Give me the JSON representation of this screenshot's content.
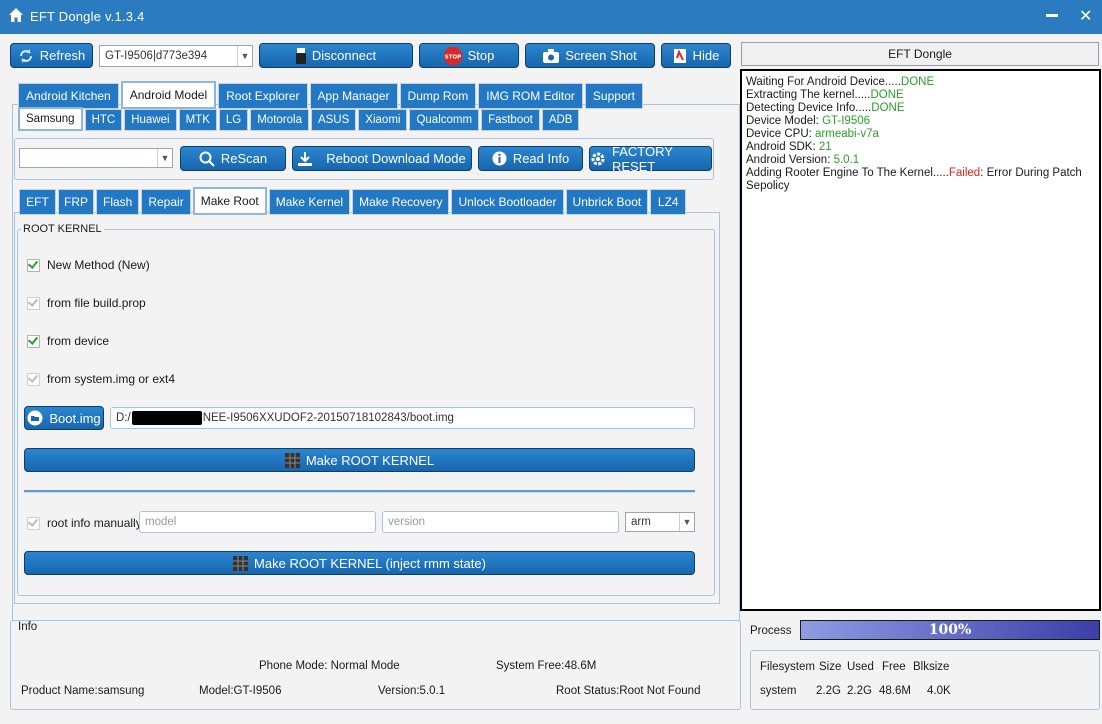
{
  "window": {
    "title": "EFT Dongle  v.1.3.4"
  },
  "toolbar": {
    "refresh": "Refresh",
    "device_combo": "GT-I9506|d773e394",
    "disconnect": "Disconnect",
    "stop": "Stop",
    "stop_sign": "STOP",
    "screenshot": "Screen Shot",
    "hide": "Hide"
  },
  "right_header": "EFT Dongle",
  "main_tabs": [
    "Android Kitchen",
    "Android Model",
    "Root Explorer",
    "App Manager",
    "Dump Rom",
    "IMG ROM Editor",
    "Support"
  ],
  "brand_tabs": [
    "Samsung",
    "HTC",
    "Huawei",
    "MTK",
    "LG",
    "Motorola",
    "ASUS",
    "Xiaomi",
    "Qualcomm",
    "Fastboot",
    "ADB"
  ],
  "actions": {
    "model_combo": "",
    "rescan": "ReScan",
    "reboot_download": "Reboot  Download Mode",
    "read_info": "Read Info",
    "factory_reset": "FACTORY RESET"
  },
  "op_tabs": [
    "EFT",
    "FRP",
    "Flash",
    "Repair",
    "Make Root",
    "Make Kernel",
    "Make Recovery",
    "Unlock Bootloader",
    "Unbrick Boot",
    "LZ4"
  ],
  "root_kernel": {
    "group_title": "ROOT KERNEL",
    "opt_new_method": "New Method (New)",
    "opt_file_build": "from file build.prop",
    "opt_device": "from device",
    "opt_system_img": "from system.img or ext4",
    "boot_button": "Boot.img",
    "boot_path_prefix": "D:/",
    "boot_path_suffix": "NEE-I9506XXUDOF2-20150718102843/boot.img",
    "make_button": "Make  ROOT KERNEL",
    "root_info_manually": "root info manually",
    "model_placeholder": "model",
    "version_placeholder": "version",
    "arch": "arm",
    "make_inject_button": "Make  ROOT KERNEL (inject rmm state)"
  },
  "log": {
    "l1a": "Waiting For Android Device.....",
    "l1b": "DONE",
    "l2a": "Extracting The kernel.....",
    "l2b": "DONE",
    "l3a": "Detecting Device Info.....",
    "l3b": "DONE",
    "l4a": "Device Model: ",
    "l4b": "GT-I9506",
    "l5a": "Device CPU: ",
    "l5b": "armeabi-v7a",
    "l6a": "Android SDK: ",
    "l6b": "21",
    "l7a": "Android Version: ",
    "l7b": "5.0.1",
    "l8a": "Adding Rooter Engine To The Kernel.....",
    "l8b": "Failed",
    "l8c": ": Error During Patch Sepolicy"
  },
  "info": {
    "title": "Info",
    "phone_mode": "Phone Mode: Normal Mode",
    "system_free": "System Free:48.6M",
    "product_name": "Product Name:samsung",
    "model": "Model:GT-I9506",
    "version": "Version:5.0.1",
    "root_status": "Root Status:Root Not Found"
  },
  "process": {
    "label": "Process",
    "percent_text": "100%",
    "value": 1.0
  },
  "fs_table": {
    "headers": [
      "Filesystem",
      "Size",
      "Used",
      "Free",
      "Blksize"
    ],
    "rows": [
      [
        "system",
        "2.2G",
        "2.2G",
        "48.6M",
        "4.0K"
      ]
    ]
  },
  "colors": {
    "accent": "#2278c2",
    "title_bar": "#2a7bc0",
    "done": "#2aa02a",
    "failed": "#e02020"
  }
}
